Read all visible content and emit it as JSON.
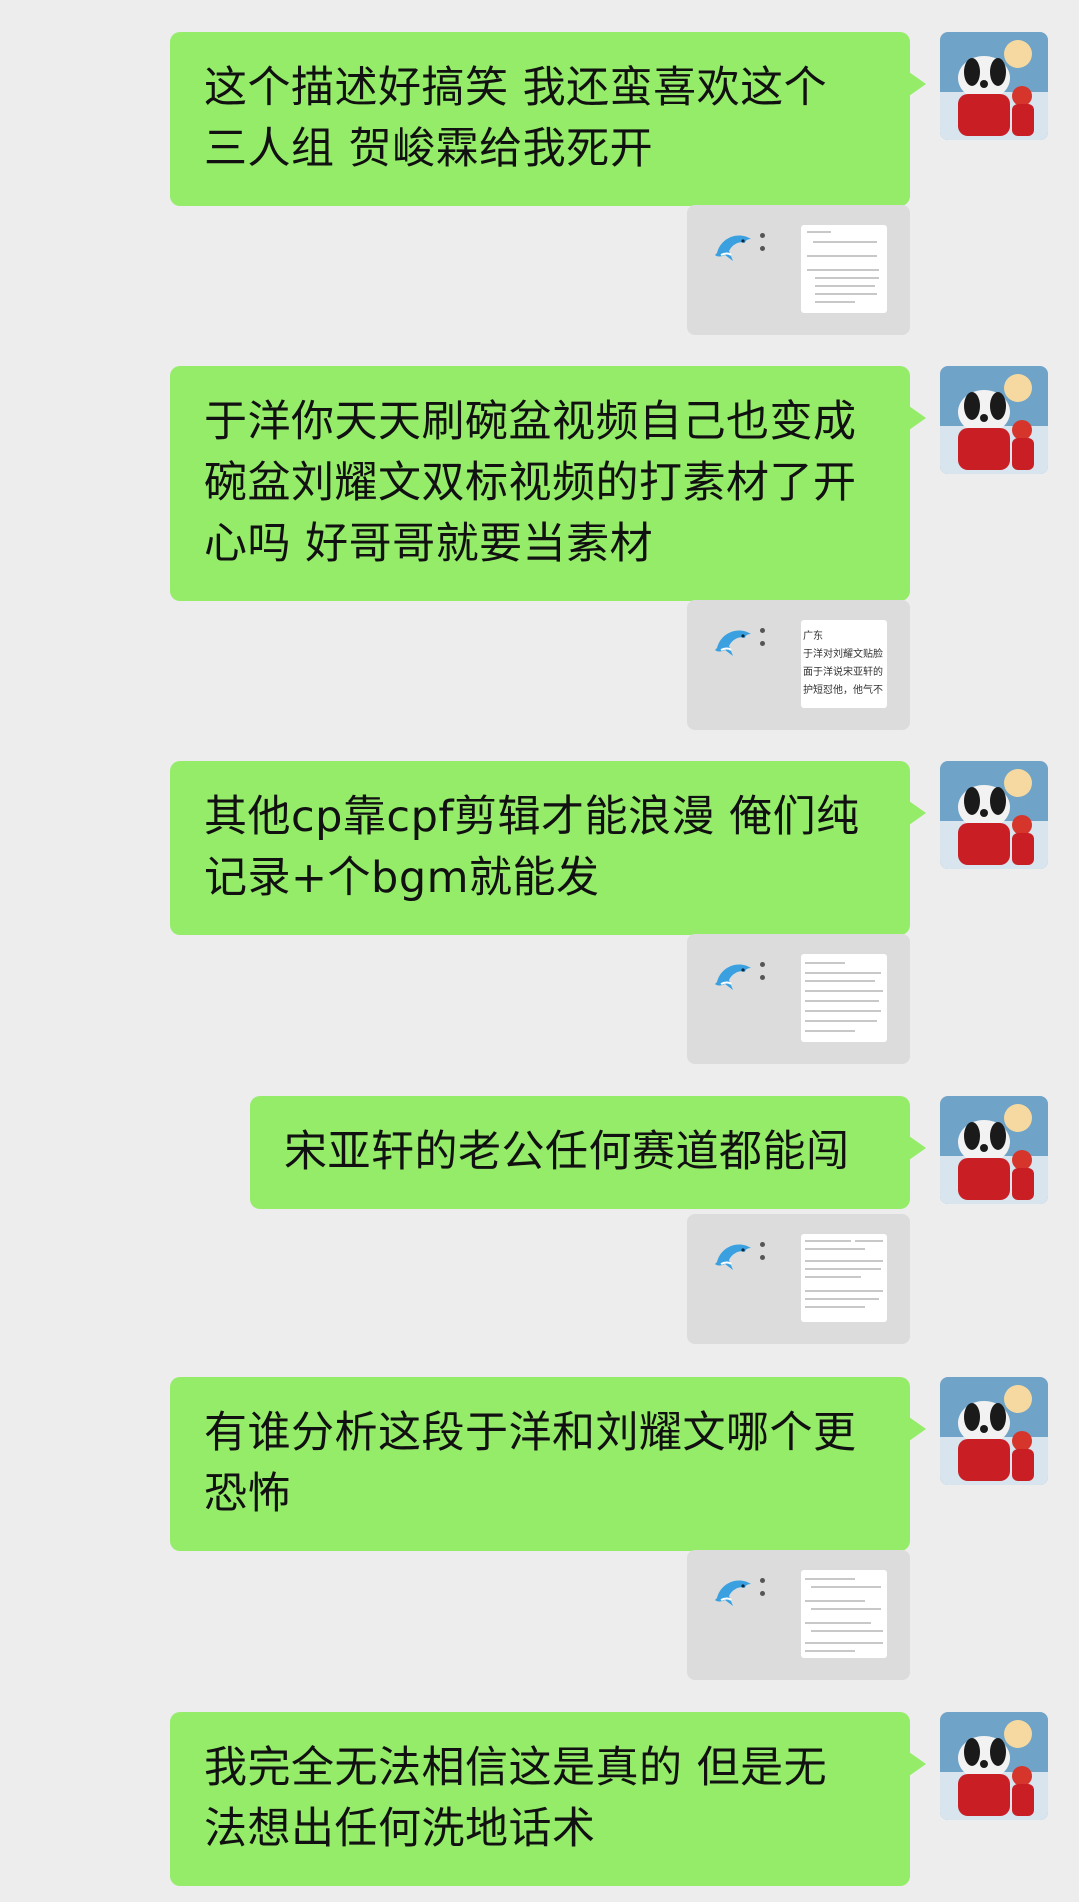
{
  "chat": {
    "messages": [
      {
        "type": "text",
        "sender": "self",
        "lines": [
          "这个描述好搞笑 我还蛮喜欢这个",
          "三人组 贺峻霖给我死开"
        ]
      },
      {
        "type": "image-card",
        "icon": "dolphin-icon"
      },
      {
        "type": "text",
        "sender": "self",
        "lines": [
          "于洋你天天刷碗盆视频自己也变成",
          "碗盆刘耀文双标视频的打素材了开",
          "心吗 好哥哥就要当素材"
        ]
      },
      {
        "type": "image-card",
        "icon": "dolphin-icon",
        "thumb_text": [
          "广东",
          "于洋对刘耀文贴脸",
          "面于洋说宋亚轩的",
          "护短怼他，他气不"
        ]
      },
      {
        "type": "text",
        "sender": "self",
        "lines": [
          "其他cp靠cpf剪辑才能浪漫 俺们纯",
          "记录+个bgm就能发"
        ]
      },
      {
        "type": "image-card",
        "icon": "dolphin-icon"
      },
      {
        "type": "text",
        "sender": "self",
        "lines": [
          "宋亚轩的老公任何赛道都能闯"
        ]
      },
      {
        "type": "image-card",
        "icon": "dolphin-icon"
      },
      {
        "type": "text",
        "sender": "self",
        "lines": [
          "有谁分析这段于洋和刘耀文哪个更",
          "恐怖"
        ]
      },
      {
        "type": "image-card",
        "icon": "dolphin-icon"
      },
      {
        "type": "text",
        "sender": "self",
        "lines": [
          "我完全无法相信这是真的 但是无",
          "法想出任何洗地话术"
        ]
      }
    ]
  },
  "colors": {
    "background": "#EDEDED",
    "bubble_self": "#95EC69",
    "card_bg": "#DCDCDC"
  }
}
